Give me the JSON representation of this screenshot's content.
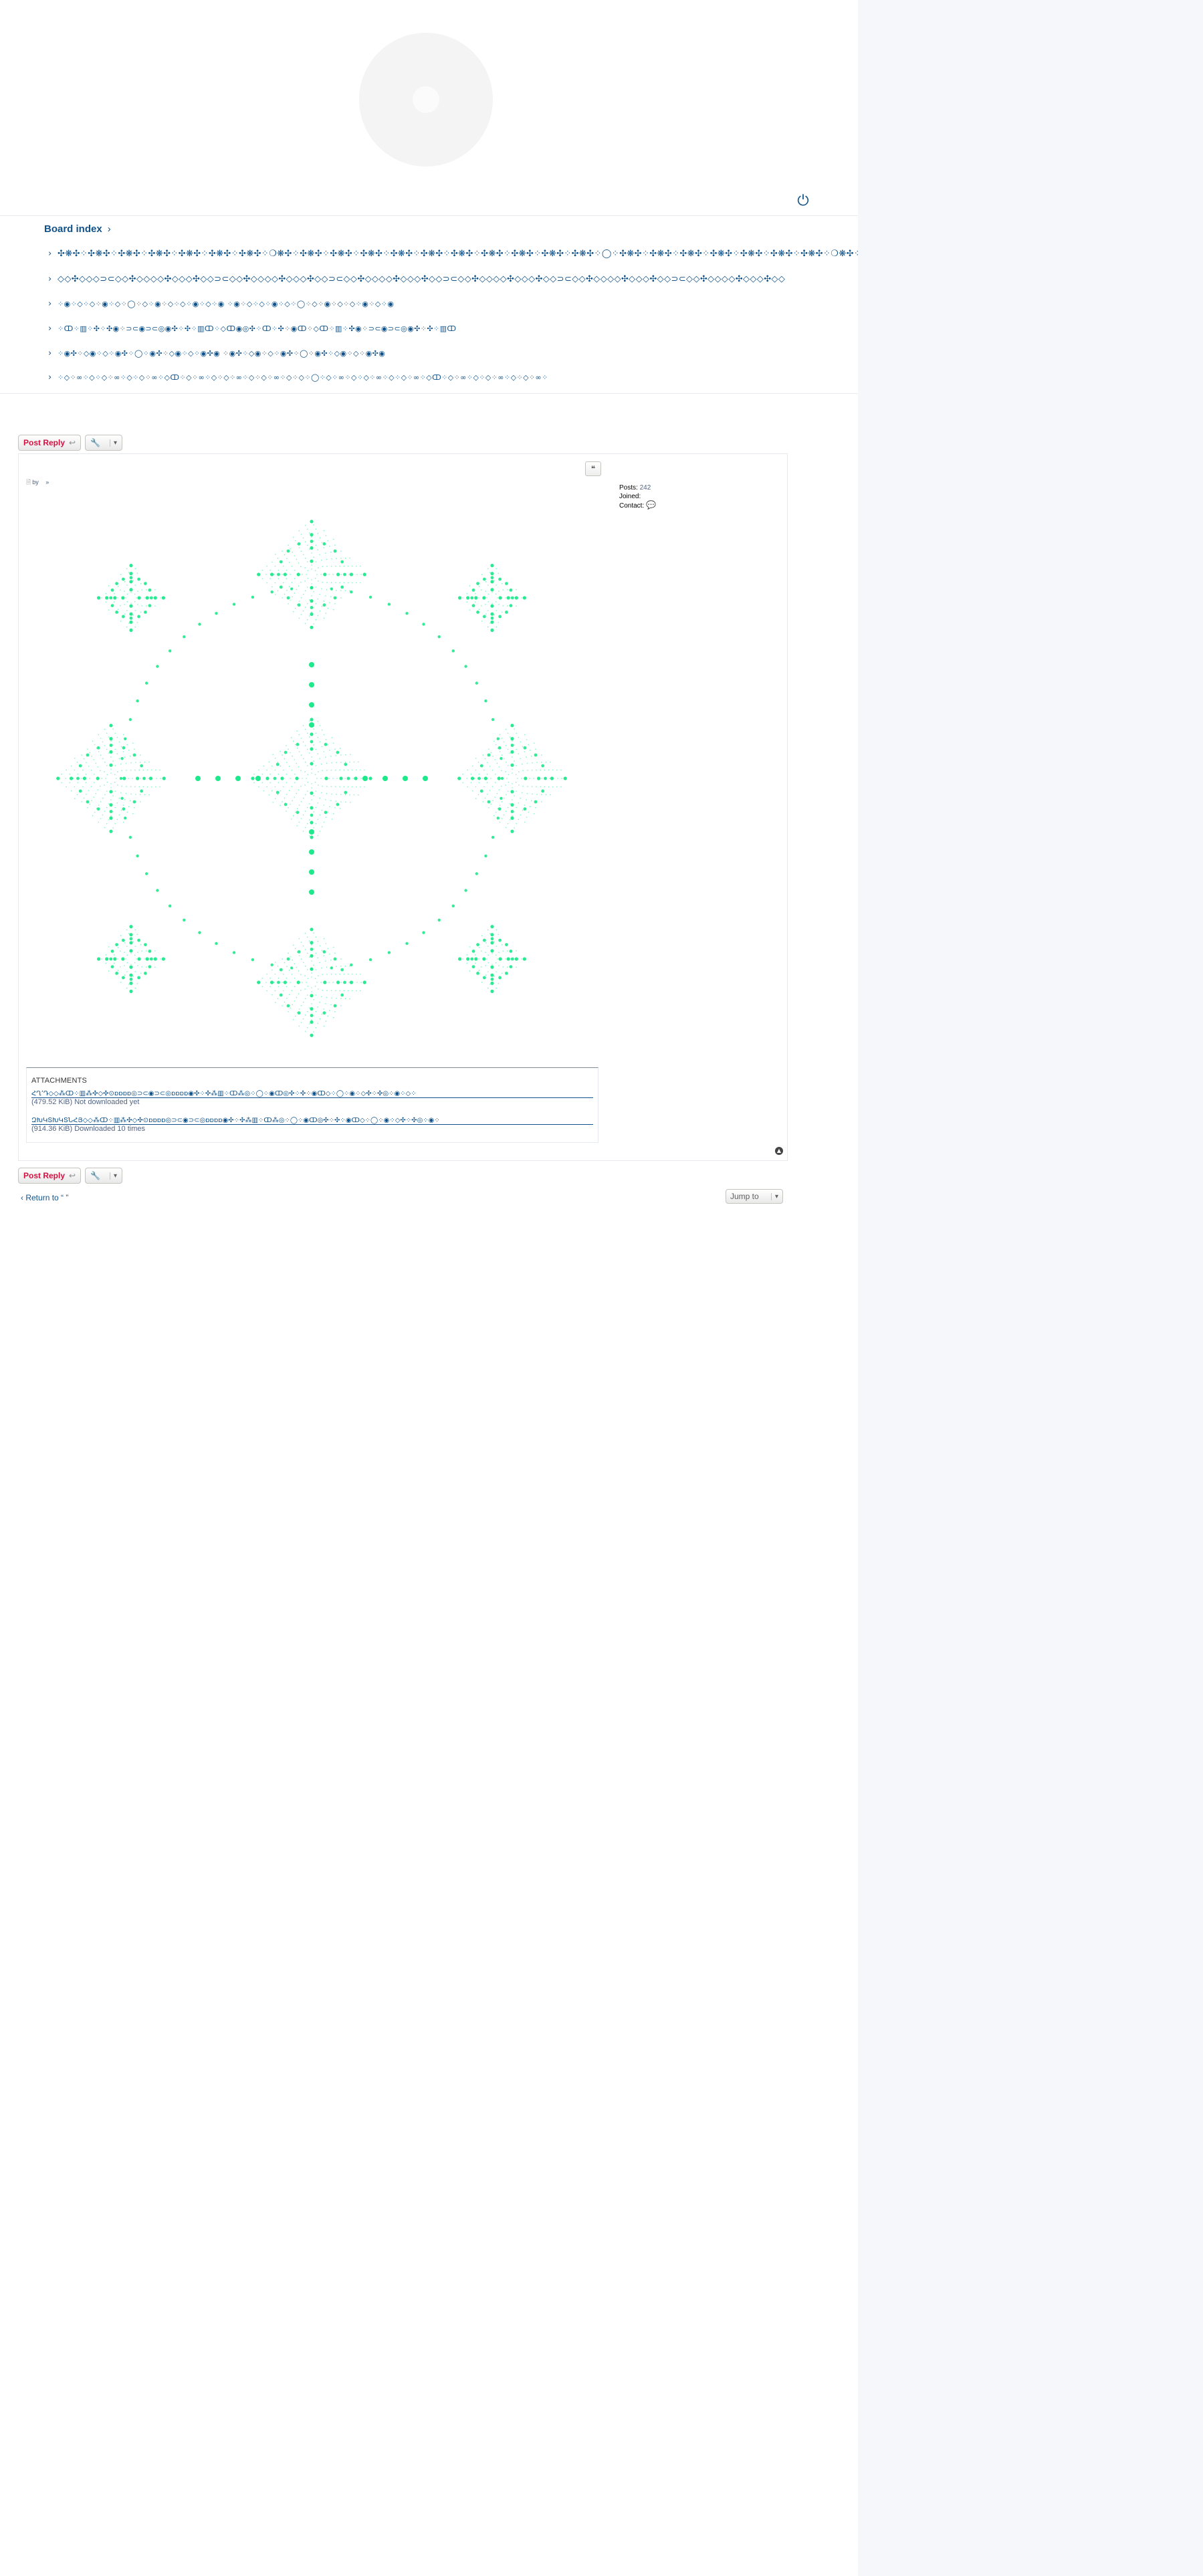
{
  "header": {
    "logo_icon": "forum-logo-icon",
    "power_icon": "power-icon"
  },
  "breadcrumb": {
    "label": "Board index",
    "separator": "›"
  },
  "forums": [
    {
      "label": "✣❋✣⁘✣❋✣⁘✣❋✣⁘✣❋✣⁘✣❋✣⁘✣❋✣⁘✣❋✣⁘❍❋✣⁘✣❋✣⁘✣❋✣⁘✣❋✣⁘✣❋✣⁘✣❋✣⁘✣❋✣⁘✣❋✣⁘✣❋✣⁘✣❋✣⁘✣❋✣⁘◯⁘✣❋✣⁘✣❋✣⁘✣❋✣⁘✣❋✣⁘✣❋✣⁘✣❋✣⁘✣❋✣⁘❍❋✣⁘✣❋✣⁘✣❋✣⁘✣❋✣⁘✣❋✣⁘✣❋✣⁘✣❋✣⁘"
    },
    {
      "label": "◇◇✣◇◇◇⊃⊂◇◇✣◇◇◇◇✣◇◇◇✣◇◇⊃⊂◇◇✣◇◇◇◇✣◇◇◇✣◇◇⊃⊂◇◇✣◇◇◇◇✣◇◇◇✣◇◇⊃⊂◇◇✣◇◇◇◇✣◇◇◇✣◇◇⊃⊂◇◇✣◇◇◇◇✣◇◇◇✣◇◇⊃⊂◇◇✣◇◇◇◇✣◇◇◇✣◇◇"
    },
    {
      "label": "⁘◉⁘◇⁘◇⁘◉⁘◇⁘◯⁘◇⁘◉⁘◇⁘◇⁘◉⁘◇⁘◉        ⁘◉⁘◇⁘◇⁘◉⁘◇⁘◯⁘◇⁘◉⁘◇⁘◇⁘◉⁘◇⁘◉"
    },
    {
      "label": "⁘ↀ⁘▥⁘✣⁘✣◉⁘⊃⊂◉⊃⊂◎◉✣⁘✣⁘▥ↀ⁘◇ↀ◉◎✣⁘ↀ⁘✣⁘◉ↀ⁘◇ↀ⁘▥⁘✣◉⁘⊃⊂◉⊃⊂◎◉✣⁘✣⁘▥ↀ"
    },
    {
      "label": "⁘◉✣⁘◇◉⁘◇⁘◉✣⁘◯⁘◉✣⁘◇◉⁘◇⁘◉✣◉        ⁘◉✣⁘◇◉⁘◇⁘◉✣⁘◯⁘◉✣⁘◇◉⁘◇⁘◉✣◉"
    },
    {
      "label": "⁘◇⁘∞⁘◇⁘◇⁘∞⁘◇⁘◇⁘∞⁘◇ↀ⁘◇⁘∞⁘◇⁘◇⁘∞⁘◇⁘◇⁘∞⁘◇⁘◇⁘◯⁘◇⁘∞⁘◇⁘◇⁘∞⁘◇⁘◇⁘∞⁘◇ↀ⁘◇⁘∞⁘◇⁘◇⁘∞⁘◇⁘◇⁘∞⁘"
    }
  ],
  "actions": {
    "post_reply": "Post Reply",
    "reply_icon": "reply-arrow-icon",
    "tools_icon": "wrench-icon",
    "caret": "▾"
  },
  "post": {
    "author_prefix": "by",
    "author_mark": "»",
    "quote_icon": "quote-icon",
    "profile": {
      "posts_label": "Posts:",
      "posts_value": "242",
      "joined_label": "Joined:",
      "contact_label": "Contact:",
      "contact_icon": "chat-bubble-icon"
    },
    "image_colors": {
      "accent": "#1de88c"
    },
    "attachments_title": "ATTACHMENTS",
    "attachments": [
      {
        "name": "ՀՂ՚Դ◇◇⁂ↀ⁘▥⁂✣◇✣⊙ɒɒɒɒ◎⊃⊂◉⊃⊂◎ɒɒɒɒ◉✣⁘✣⁂▥⁘ↀ⁂◎⁘◯⁘◉ↀ◎✣⁘✣⁘◉ↀ◇⁘◯⁘◉⁘◇✣⁘✣◎⁘◉⁘◇⁘",
        "meta": "(479.52 KiB) Not downloaded yet"
      },
      {
        "name": "ԶԽԿՏԽԿՏՆՀՅ◇◇⁂ↀ⁘▥⁂✣◇✣⊙ɒɒɒɒ◎⊃⊂◉⊃⊂◎ɒɒɒɒ◉✣⁘✣⁂▥⁘ↀ⁂◎⁘◯⁘◉ↀ◎✣⁘✣⁘◉ↀ◇⁘◯⁘◉⁘◇✣⁘✣◎⁘◉⁘",
        "meta": "(914.36 KiB) Downloaded 10 times"
      }
    ],
    "top_icon": "back-to-top-icon"
  },
  "footer": {
    "return_label": "Return to “ ”",
    "return_icon": "chevron-left-icon",
    "jump_label": "Jump to"
  }
}
